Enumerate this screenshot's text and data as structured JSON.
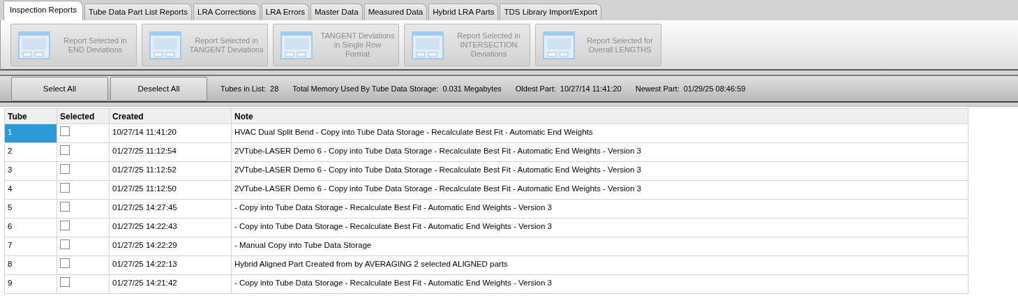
{
  "tabs": [
    {
      "label": "Inspection Reports",
      "selected": true
    },
    {
      "label": "Tube Data Part List Reports",
      "selected": false
    },
    {
      "label": "LRA Corrections",
      "selected": false
    },
    {
      "label": "LRA Errors",
      "selected": false
    },
    {
      "label": "Master Data",
      "selected": false
    },
    {
      "label": "Measured Data",
      "selected": false
    },
    {
      "label": "Hybrid LRA Parts",
      "selected": false
    },
    {
      "label": "TDS Library Import/Export",
      "selected": false
    }
  ],
  "toolbar": {
    "buttons": [
      {
        "lines": [
          "Report Selected in",
          "END Deviations"
        ],
        "disabled": true
      },
      {
        "lines": [
          "Report Selected in",
          "TANGENT Deviations"
        ],
        "disabled": true
      },
      {
        "lines": [
          "TANGENT Deviations",
          "in Single Row",
          "Format"
        ],
        "disabled": true
      },
      {
        "lines": [
          "Report Selected in",
          "INTERSECTION",
          "Deviations"
        ],
        "disabled": true
      },
      {
        "lines": [
          "Report Selected for",
          "Overall LENGTHS"
        ],
        "disabled": true
      }
    ]
  },
  "info_bar": {
    "buttons": [
      "Select All",
      "Deselect All"
    ],
    "stats": [
      {
        "label": "Tubes in List:",
        "value": "28"
      },
      {
        "label": "Total Memory Used By Tube Data Storage:",
        "value": "0.031  Megabytes"
      },
      {
        "label": "Oldest Part:",
        "value": "10/27/14 11:41:20"
      },
      {
        "label": "Newest Part:",
        "value": "01/29/25 08:46:59"
      }
    ]
  },
  "table": {
    "columns": [
      "Tube",
      "Selected",
      "Created",
      "Note"
    ],
    "rows": [
      {
        "tube": "1",
        "checked": false,
        "created": "10/27/14 11:41:20",
        "note": "HVAC Dual Split Bend - Copy into Tube Data Storage - Recalculate Best Fit - Automatic End Weights",
        "selected": true
      },
      {
        "tube": "2",
        "checked": false,
        "created": "01/27/25 11:12:54",
        "note": "2VTube-LASER Demo 6 - Copy into Tube Data Storage - Recalculate Best Fit - Automatic End Weights - Version 3",
        "selected": false
      },
      {
        "tube": "3",
        "checked": false,
        "created": "01/27/25 11:12:52",
        "note": "2VTube-LASER Demo 6 - Copy into Tube Data Storage - Recalculate Best Fit - Automatic End Weights - Version 3",
        "selected": false
      },
      {
        "tube": "4",
        "checked": false,
        "created": "01/27/25 11:12:50",
        "note": "2VTube-LASER Demo 6 - Copy into Tube Data Storage - Recalculate Best Fit - Automatic End Weights - Version 3",
        "selected": false
      },
      {
        "tube": "5",
        "checked": false,
        "created": "01/27/25 14:27:45",
        "note": " - Copy into Tube Data Storage - Recalculate Best Fit - Automatic End Weights - Version 3",
        "selected": false
      },
      {
        "tube": "6",
        "checked": false,
        "created": "01/27/25 14:22:43",
        "note": " - Copy into Tube Data Storage - Recalculate Best Fit - Automatic End Weights - Version 3",
        "selected": false
      },
      {
        "tube": "7",
        "checked": false,
        "created": "01/27/25 14:22:29",
        "note": " - Manual Copy into Tube Data Storage",
        "selected": false
      },
      {
        "tube": "8",
        "checked": false,
        "created": "01/27/25 14:22:13",
        "note": "Hybrid Aligned Part Created from by AVERAGING 2 selected ALIGNED parts",
        "selected": false
      },
      {
        "tube": "9",
        "checked": false,
        "created": "01/27/25 14:21:42",
        "note": " - Copy into Tube Data Storage - Recalculate Best Fit - Automatic End Weights - Version 3",
        "selected": false
      }
    ]
  }
}
